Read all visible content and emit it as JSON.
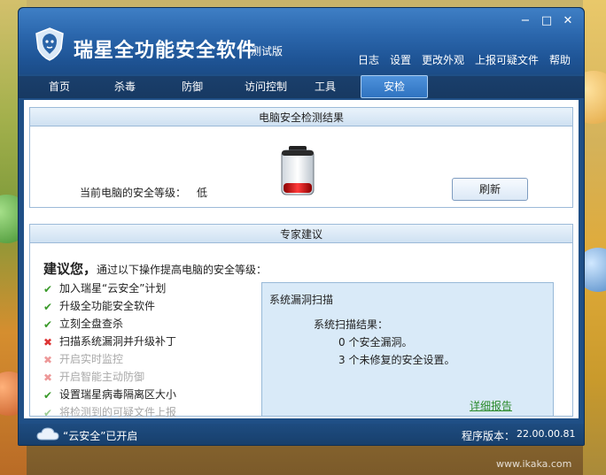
{
  "window": {
    "app_title": "瑞星全功能安全软件",
    "edition": "测试版",
    "controls": {
      "minimize": "−",
      "maximize": "□",
      "close": "✕"
    }
  },
  "top_menu": [
    "日志",
    "设置",
    "更改外观",
    "上报可疑文件",
    "帮助"
  ],
  "tabs": [
    "首页",
    "杀毒",
    "防御",
    "访问控制",
    "工具",
    "安检"
  ],
  "active_tab": "安检",
  "security_result": {
    "title": "电脑安全检测结果",
    "level_label": "当前电脑的安全等级：",
    "level_value": "低",
    "refresh_button": "刷新",
    "battery_level": 0.25
  },
  "expert": {
    "title": "专家建议",
    "heading_bold": "建议您，",
    "heading_rest": "通过以下操作提高电脑的安全等级：",
    "items": [
      {
        "label": "加入瑞星“云安全”计划",
        "status": "ok",
        "faded": false
      },
      {
        "label": "升级全功能安全软件",
        "status": "ok",
        "faded": false
      },
      {
        "label": "立刻全盘查杀",
        "status": "ok",
        "faded": false
      },
      {
        "label": "扫描系统漏洞并升级补丁",
        "status": "bad",
        "faded": false
      },
      {
        "label": "开启实时监控",
        "status": "bad",
        "faded": true
      },
      {
        "label": "开启智能主动防御",
        "status": "bad",
        "faded": true
      },
      {
        "label": "设置瑞星病毒隔离区大小",
        "status": "ok",
        "faded": false
      },
      {
        "label": "将检测到的可疑文件上报",
        "status": "ok",
        "faded": true
      }
    ],
    "panel": {
      "title": "系统漏洞扫描",
      "result_label": "系统扫描结果：",
      "line1": "0 个安全漏洞。",
      "line2": "3 个未修复的安全设置。",
      "detail_link": "详细报告"
    }
  },
  "status_bar": {
    "cloud_status": "“云安全”已开启",
    "version_label": "程序版本：",
    "version_value": "22.00.00.81"
  },
  "watermark": "www.ikaka.com",
  "colors": {
    "title_bar": "#2b67ad",
    "tab_bar": "#173962",
    "active_tab": "#2f73c0",
    "panel_bg": "#d9eaf8",
    "ok_green": "#3a9a2a",
    "bad_red": "#dd3333",
    "link_green": "#2a8a2a"
  },
  "icons": {
    "logo": "lion-shield-icon",
    "battery": "battery-level-icon",
    "cloud": "cloud-icon",
    "check": "check-icon",
    "cross": "cross-icon"
  }
}
